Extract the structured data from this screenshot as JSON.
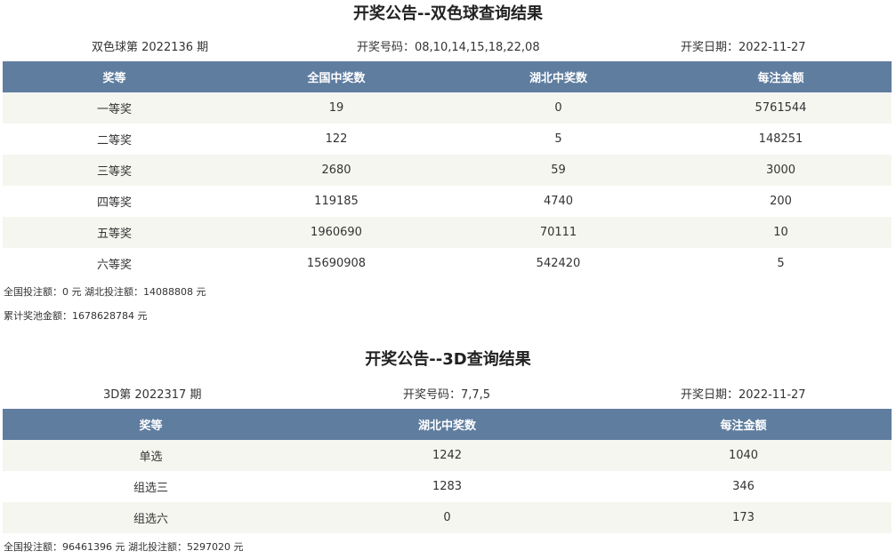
{
  "ssq": {
    "title": "开奖公告--双色球查询结果",
    "issue": "双色球第 2022136 期",
    "numbers": "开奖号码：08,10,14,15,18,22,08",
    "date": "开奖日期：2022-11-27",
    "headers": [
      "奖等",
      "全国中奖数",
      "湖北中奖数",
      "每注金额"
    ],
    "rows": [
      [
        "一等奖",
        "19",
        "0",
        "5761544"
      ],
      [
        "二等奖",
        "122",
        "5",
        "148251"
      ],
      [
        "三等奖",
        "2680",
        "59",
        "3000"
      ],
      [
        "四等奖",
        "119185",
        "4740",
        "200"
      ],
      [
        "五等奖",
        "1960690",
        "70111",
        "10"
      ],
      [
        "六等奖",
        "15690908",
        "542420",
        "5"
      ]
    ],
    "sales": "全国投注额：0 元 湖北投注额：14088808 元",
    "pool": "累计奖池金额：1678628784 元"
  },
  "fc3d": {
    "title": "开奖公告--3D查询结果",
    "issue": "3D第 2022317 期",
    "numbers": "开奖号码：7,7,5",
    "date": "开奖日期：2022-11-27",
    "headers": [
      "奖等",
      "湖北中奖数",
      "每注金额"
    ],
    "rows": [
      [
        "单选",
        "1242",
        "1040"
      ],
      [
        "组选三",
        "1283",
        "346"
      ],
      [
        "组选六",
        "0",
        "173"
      ]
    ],
    "sales": "全国投注额：96461396 元 湖北投注额：5297020 元"
  }
}
